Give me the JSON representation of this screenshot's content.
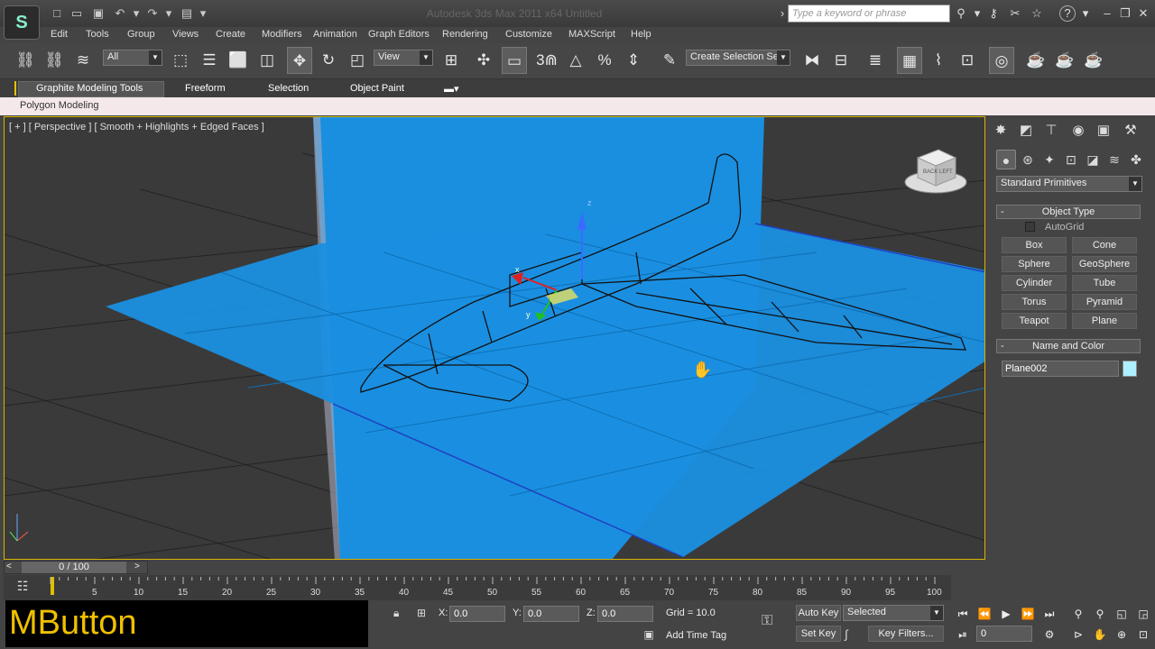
{
  "title_bar": {
    "window_title": "Autodesk 3ds Max 2011 x64    Untitled",
    "search_placeholder": "Type a keyword or phrase",
    "logo_glyph": "S",
    "help_glyph": "?"
  },
  "menu": [
    "Edit",
    "Tools",
    "Group",
    "Views",
    "Create",
    "Modifiers",
    "Animation",
    "Graph Editors",
    "Rendering",
    "Customize",
    "MAXScript",
    "Help"
  ],
  "toolbar": {
    "selection_filter": "All",
    "reference_coord": "View",
    "named_selection": "Create Selection Se",
    "snap_value": "3"
  },
  "ribbon": {
    "tabs": [
      "Graphite Modeling Tools",
      "Freeform",
      "Selection",
      "Object Paint"
    ],
    "panel_label": "Polygon Modeling"
  },
  "viewport": {
    "label": "[ + ] [ Perspective ] [ Smooth + Highlights + Edged Faces ]",
    "gizmo_axes": [
      "x",
      "y",
      "z"
    ],
    "viewcube_top_text": "BACK",
    "viewcube_front_text": "LEFT"
  },
  "command_panel": {
    "category_dropdown": "Standard Primitives",
    "object_type_title": "Object Type",
    "autogrid_label": "AutoGrid",
    "primitives": [
      "Box",
      "Cone",
      "Sphere",
      "GeoSphere",
      "Cylinder",
      "Tube",
      "Torus",
      "Pyramid",
      "Teapot",
      "Plane"
    ],
    "name_color_title": "Name and Color",
    "object_name": "Plane002",
    "object_color": "#aef0ff"
  },
  "timeline": {
    "slider_text": "0 / 100",
    "slider_left": "<",
    "slider_right": ">",
    "ticks": [
      "5",
      "10",
      "15",
      "20",
      "25",
      "30",
      "35",
      "40",
      "45",
      "50",
      "55",
      "60",
      "65",
      "70",
      "75",
      "80",
      "85",
      "90",
      "95",
      "100"
    ]
  },
  "status": {
    "mbutton_text": "MButton",
    "x_label": "X:",
    "x_value": "0.0",
    "y_label": "Y:",
    "y_value": "0.0",
    "z_label": "Z:",
    "z_value": "0.0",
    "grid": "Grid = 10.0",
    "add_time_tag": "Add Time Tag",
    "auto_key": "Auto Key",
    "set_key": "Set Key",
    "key_mode": "Selected",
    "key_filters": "Key Filters...",
    "frame_value": "0"
  },
  "colors": {
    "plane_blue": "#1a8fe0",
    "accent_yellow": "#e6c200"
  }
}
